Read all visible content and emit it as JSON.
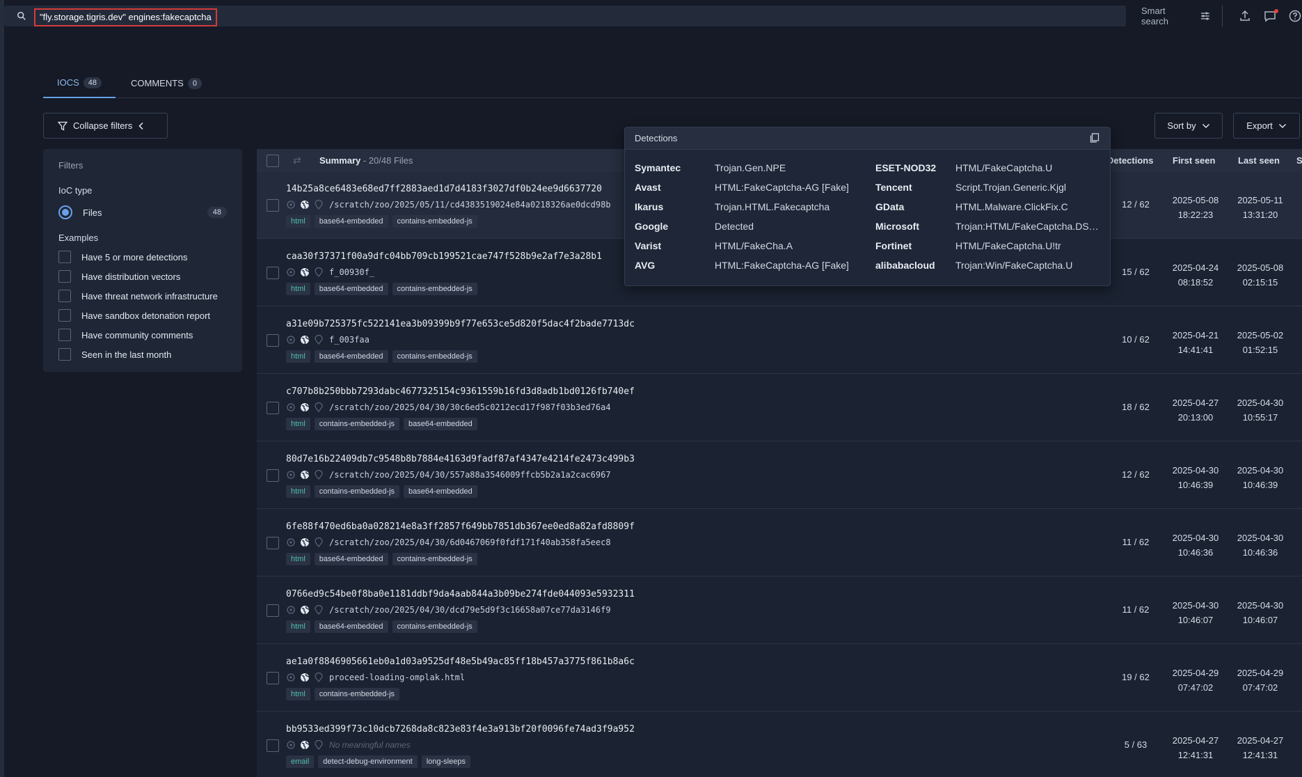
{
  "search": {
    "query": "\"fly.storage.tigris.dev\" engines:fakecaptcha",
    "smart_search_label": "Smart search"
  },
  "tabs": [
    {
      "label": "IOCS",
      "count": "48"
    },
    {
      "label": "COMMENTS",
      "count": "0"
    }
  ],
  "filters": {
    "collapse_label": "Collapse filters",
    "title": "Filters",
    "ioc_type_label": "IoC type",
    "ioc_type_option": "Files",
    "ioc_type_count": "48",
    "examples_label": "Examples",
    "examples": [
      "Have 5 or more detections",
      "Have distribution vectors",
      "Have threat network infrastructure",
      "Have sandbox detonation report",
      "Have community comments",
      "Seen in the last month"
    ]
  },
  "toolbar": {
    "sort_label": "Sort by",
    "export_label": "Export"
  },
  "table": {
    "summary_label": "Summary",
    "summary_count": " - 20/48 Files",
    "col_detections": "Detections",
    "col_first_seen": "First seen",
    "col_last_seen": "Last seen",
    "col_s": "S",
    "rows": [
      {
        "hash": "14b25a8ce6483e68ed7ff2883aed1d7d4183f3027df0b24ee9d6637720",
        "path": "/scratch/zoo/2025/05/11/cd4383519024e84a0218326ae0dcd98b",
        "tags": [
          "html",
          "base64-embedded",
          "contains-embedded-js"
        ],
        "detections": "12 / 62",
        "first_date": "2025-05-08",
        "first_time": "18:22:23",
        "last_date": "2025-05-11",
        "last_time": "13:31:20"
      },
      {
        "hash": "caa30f37371f00a9dfc04bb709cb199521cae747f528b9e2af7e3a28b1",
        "path": "f_00930f_",
        "tags": [
          "html",
          "base64-embedded",
          "contains-embedded-js"
        ],
        "detections": "15 / 62",
        "first_date": "2025-04-24",
        "first_time": "08:18:52",
        "last_date": "2025-05-08",
        "last_time": "02:15:15"
      },
      {
        "hash": "a31e09b725375fc522141ea3b09399b9f77e653ce5d820f5dac4f2bade7713dc",
        "path": "f_003faa",
        "tags": [
          "html",
          "base64-embedded",
          "contains-embedded-js"
        ],
        "detections": "10 / 62",
        "first_date": "2025-04-21",
        "first_time": "14:41:41",
        "last_date": "2025-05-02",
        "last_time": "01:52:15"
      },
      {
        "hash": "c707b8b250bbb7293dabc4677325154c9361559b16fd3d8adb1bd0126fb740ef",
        "path": "/scratch/zoo/2025/04/30/30c6ed5c0212ecd17f987f03b3ed76a4",
        "tags": [
          "html",
          "contains-embedded-js",
          "base64-embedded"
        ],
        "detections": "18 / 62",
        "first_date": "2025-04-27",
        "first_time": "20:13:00",
        "last_date": "2025-04-30",
        "last_time": "10:55:17"
      },
      {
        "hash": "80d7e16b22409db7c9548b8b7884e4163d9fadf87af4347e4214fe2473c499b3",
        "path": "/scratch/zoo/2025/04/30/557a88a3546009ffcb5b2a1a2cac6967",
        "tags": [
          "html",
          "contains-embedded-js",
          "base64-embedded"
        ],
        "detections": "12 / 62",
        "first_date": "2025-04-30",
        "first_time": "10:46:39",
        "last_date": "2025-04-30",
        "last_time": "10:46:39"
      },
      {
        "hash": "6fe88f470ed6ba0a028214e8a3ff2857f649bb7851db367ee0ed8a82afd8809f",
        "path": "/scratch/zoo/2025/04/30/6d0467069f0fdf171f40ab358fa5eec8",
        "tags": [
          "html",
          "base64-embedded",
          "contains-embedded-js"
        ],
        "detections": "11 / 62",
        "first_date": "2025-04-30",
        "first_time": "10:46:36",
        "last_date": "2025-04-30",
        "last_time": "10:46:36"
      },
      {
        "hash": "0766ed9c54be0f8ba0e1181ddbf9da4aab844a3b09be274fde044093e5932311",
        "path": "/scratch/zoo/2025/04/30/dcd79e5d9f3c16658a07ce77da3146f9",
        "tags": [
          "html",
          "base64-embedded",
          "contains-embedded-js"
        ],
        "detections": "11 / 62",
        "first_date": "2025-04-30",
        "first_time": "10:46:07",
        "last_date": "2025-04-30",
        "last_time": "10:46:07"
      },
      {
        "hash": "ae1a0f8846905661eb0a1d03a9525df48e5b49ac85ff18b457a3775f861b8a6c",
        "path": "proceed-loading-omplak.html",
        "tags": [
          "html",
          "contains-embedded-js"
        ],
        "detections": "19 / 62",
        "first_date": "2025-04-29",
        "first_time": "07:47:02",
        "last_date": "2025-04-29",
        "last_time": "07:47:02"
      },
      {
        "hash": "bb9533ed399f73c10dcb7268da8c823e83f4e3a913bf20f0096fe74ad3f9a952",
        "path": "No meaningful names",
        "path_empty": true,
        "tags": [
          "email",
          "detect-debug-environment",
          "long-sleeps"
        ],
        "detections": "5 / 63",
        "first_date": "2025-04-27",
        "first_time": "12:41:31",
        "last_date": "2025-04-27",
        "last_time": "12:41:31"
      }
    ]
  },
  "detections_popover": {
    "title": "Detections",
    "left": [
      {
        "engine": "Symantec",
        "result": "Trojan.Gen.NPE"
      },
      {
        "engine": "Avast",
        "result": "HTML:FakeCaptcha-AG [Fake]"
      },
      {
        "engine": "Ikarus",
        "result": "Trojan.HTML.Fakecaptcha"
      },
      {
        "engine": "Google",
        "result": "Detected"
      },
      {
        "engine": "Varist",
        "result": "HTML/FakeCha.A"
      },
      {
        "engine": "AVG",
        "result": "HTML:FakeCaptcha-AG [Fake]"
      }
    ],
    "right": [
      {
        "engine": "ESET-NOD32",
        "result": "HTML/FakeCaptcha.U"
      },
      {
        "engine": "Tencent",
        "result": "Script.Trojan.Generic.Kjgl"
      },
      {
        "engine": "GData",
        "result": "HTML.Malware.ClickFix.C"
      },
      {
        "engine": "Microsoft",
        "result": "Trojan:HTML/FakeCaptcha.DSK!…"
      },
      {
        "engine": "Fortinet",
        "result": "HTML/FakeCaptcha.U!tr"
      },
      {
        "engine": "alibabacloud",
        "result": "Trojan:Win/FakeCaptcha.U"
      }
    ]
  },
  "colors": {
    "accent": "#6aa0e8",
    "tag_type": "#4fc0a8",
    "highlight_border": "#d63a3a"
  }
}
